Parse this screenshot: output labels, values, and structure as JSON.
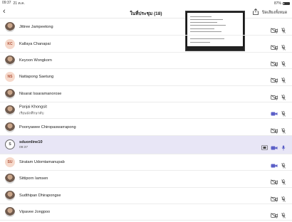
{
  "status_bar": {
    "time": "09:37",
    "date": "21 ต.ค.",
    "battery": "87%"
  },
  "header": {
    "title": "ในที่ประชุม (18)",
    "close_label": "ปิดเสียงทั้งหมด"
  },
  "colors": {
    "accent": "#5b5fc7",
    "highlight": "#e8e6f6",
    "initials_bg": "#f6d9cb",
    "initials_fg": "#b0533a"
  },
  "participants": [
    {
      "name": "Jittree Jampeetong",
      "avatar": "photo",
      "initials": "",
      "sub": "",
      "camera": "off",
      "mic": "muted"
    },
    {
      "name": "Kallaya Chanapai",
      "avatar": "initials",
      "initials": "KC",
      "sub": "",
      "camera": "off",
      "mic": "muted"
    },
    {
      "name": "Keyoon Wongkorn",
      "avatar": "photo",
      "initials": "",
      "sub": "",
      "camera": "off",
      "mic": "muted"
    },
    {
      "name": "Nattapong Saetung",
      "avatar": "initials",
      "initials": "NS",
      "sub": "",
      "camera": "off",
      "mic": "muted"
    },
    {
      "name": "Nisarat Issaramanorose",
      "avatar": "photo",
      "initials": "",
      "sub": "",
      "camera": "off",
      "mic": "muted"
    },
    {
      "name": "Panjai Khongsit",
      "avatar": "photo",
      "initials": "",
      "sub": "เรียนนักศึกษาคับ",
      "camera": "on",
      "mic": "muted"
    },
    {
      "name": "Poonyawee Chiropaswarrapong",
      "avatar": "photo",
      "initials": "",
      "sub": "",
      "camera": "off",
      "mic": "muted"
    },
    {
      "name": "sduonline10",
      "avatar": "outline",
      "initials": "S",
      "sub": "09:37",
      "camera": "on",
      "mic": "on",
      "sharing": true,
      "highlight": true
    },
    {
      "name": "Siratam Udomtamanupab",
      "avatar": "initials",
      "initials": "SU",
      "sub": "",
      "camera": "on",
      "mic": "muted"
    },
    {
      "name": "Sittiporn Iamsen",
      "avatar": "photo",
      "initials": "",
      "sub": "",
      "camera": "off",
      "mic": "muted"
    },
    {
      "name": "Sudthipan Dhirapongse",
      "avatar": "photo",
      "initials": "",
      "sub": "",
      "camera": "off",
      "mic": "muted"
    },
    {
      "name": "Vipavee Jongpoo",
      "avatar": "photo",
      "initials": "",
      "sub": "",
      "camera": "off",
      "mic": "muted"
    }
  ]
}
